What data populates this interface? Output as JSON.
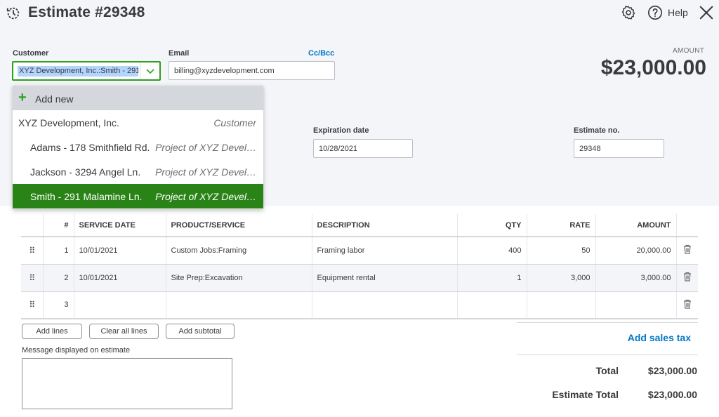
{
  "header": {
    "title": "Estimate #29348",
    "help_label": "Help"
  },
  "customer": {
    "label": "Customer",
    "value": "XYZ Development, Inc.:Smith - 291 Malamine Ln."
  },
  "email": {
    "label": "Email",
    "cc_bcc": "Cc/Bcc",
    "value": "billing@xyzdevelopment.com"
  },
  "amount": {
    "label": "AMOUNT",
    "value": "$23,000.00"
  },
  "dropdown": {
    "add_new": "Add new",
    "items": [
      {
        "name": "XYZ Development, Inc.",
        "type": "Customer"
      },
      {
        "name": "Adams - 178 Smithfield Rd.",
        "type": "Project of XYZ Devel…"
      },
      {
        "name": "Jackson - 3294 Angel Ln.",
        "type": "Project of XYZ Devel…"
      },
      {
        "name": "Smith - 291 Malamine Ln.",
        "type": "Project of XYZ Devel…"
      }
    ]
  },
  "expiration": {
    "label": "Expiration date",
    "value": "10/28/2021"
  },
  "estimate_no": {
    "label": "Estimate no.",
    "value": "29348"
  },
  "table": {
    "headers": {
      "num": "#",
      "service_date": "SERVICE DATE",
      "product": "PRODUCT/SERVICE",
      "description": "DESCRIPTION",
      "qty": "QTY",
      "rate": "RATE",
      "amount": "AMOUNT"
    },
    "rows": [
      {
        "num": "1",
        "service_date": "10/01/2021",
        "product": "Custom Jobs:Framing",
        "description": "Framing labor",
        "qty": "400",
        "rate": "50",
        "amount": "20,000.00"
      },
      {
        "num": "2",
        "service_date": "10/01/2021",
        "product": "Site Prep:Excavation",
        "description": "Equipment rental",
        "qty": "1",
        "rate": "3,000",
        "amount": "3,000.00"
      },
      {
        "num": "3",
        "service_date": "",
        "product": "",
        "description": "",
        "qty": "",
        "rate": "",
        "amount": ""
      }
    ]
  },
  "buttons": {
    "add_lines": "Add lines",
    "clear_all_lines": "Clear all lines",
    "add_subtotal": "Add subtotal"
  },
  "message": {
    "label": "Message displayed on estimate",
    "value": ""
  },
  "summary": {
    "add_sales_tax": "Add sales tax",
    "total_label": "Total",
    "total_value": "$23,000.00",
    "estimate_total_label": "Estimate Total",
    "estimate_total_value": "$23,000.00"
  },
  "colors": {
    "accent_green": "#2ca01c",
    "selected_green": "#2a8316",
    "link_blue": "#0077c5"
  }
}
